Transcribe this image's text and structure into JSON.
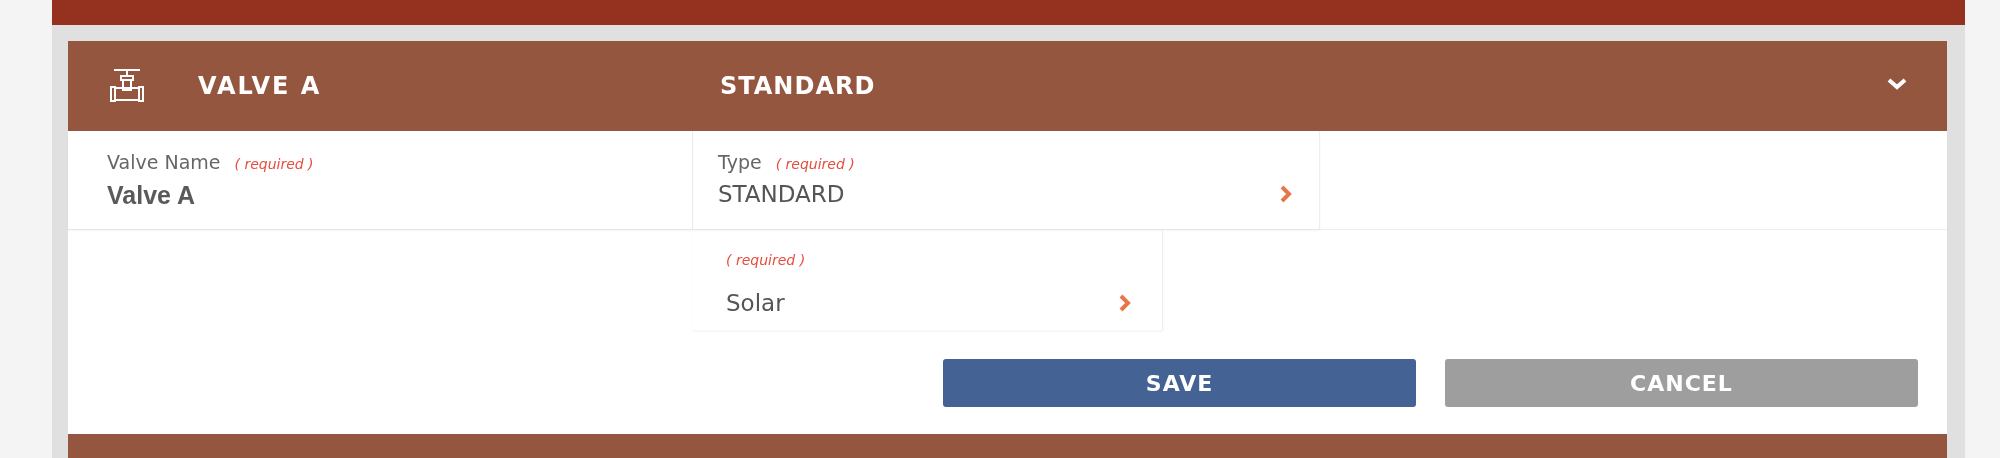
{
  "header": {
    "title": "VALVE A",
    "type": "STANDARD",
    "expanded": true
  },
  "fields": [
    {
      "label": "Valve Name",
      "hint": "( required )",
      "value": "Valve A",
      "kind": "text"
    },
    {
      "label": "Type",
      "hint": "( required )",
      "value": "STANDARD",
      "kind": "select"
    }
  ],
  "second_fields": [
    {
      "hint": "( required )",
      "value": "Solar",
      "kind": "select"
    }
  ],
  "buttons": [
    {
      "label": "SAVE",
      "kind": "primary"
    },
    {
      "label": "CANCEL",
      "kind": "secondary"
    }
  ]
}
